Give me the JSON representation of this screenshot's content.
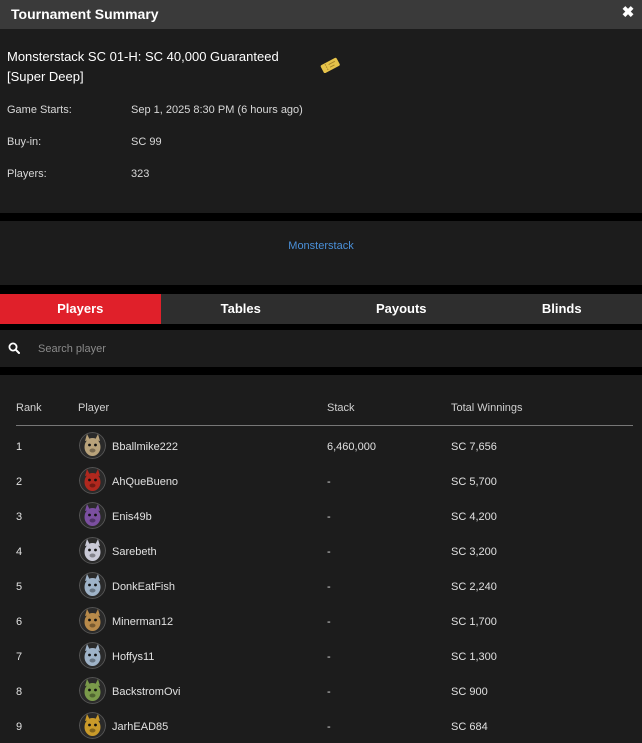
{
  "window": {
    "title": "Tournament Summary"
  },
  "tournament": {
    "name_line1": "Monsterstack SC 01-H: SC 40,000 Guaranteed",
    "name_line2": "[Super Deep]",
    "details": [
      {
        "label": "Game Starts:",
        "value": "Sep 1, 2025 8:30 PM (6 hours ago)"
      },
      {
        "label": "Buy-in:",
        "value": "SC 99"
      },
      {
        "label": "Players:",
        "value": "323"
      }
    ]
  },
  "series_link": "Monsterstack",
  "tabs": [
    "Players",
    "Tables",
    "Payouts",
    "Blinds"
  ],
  "active_tab": "Players",
  "search": {
    "placeholder": "Search player"
  },
  "table": {
    "headers": {
      "rank": "Rank",
      "player": "Player",
      "stack": "Stack",
      "winnings": "Total Winnings"
    },
    "rows": [
      {
        "rank": "1",
        "player": "Bballmike222",
        "stack": "6,460,000",
        "winnings": "SC 7,656",
        "avatar": "wolf-avatar",
        "avatar_color": "#b8a27a"
      },
      {
        "rank": "2",
        "player": "AhQueBueno",
        "stack": "-",
        "winnings": "SC 5,700",
        "avatar": "demon-avatar",
        "avatar_color": "#b0281e"
      },
      {
        "rank": "3",
        "player": "Enis49b",
        "stack": "-",
        "winnings": "SC 4,200",
        "avatar": "purple-beast-avatar",
        "avatar_color": "#7b4fa0"
      },
      {
        "rank": "4",
        "player": "Sarebeth",
        "stack": "-",
        "winnings": "SC 3,200",
        "avatar": "panda-avatar",
        "avatar_color": "#c9c9d6"
      },
      {
        "rank": "5",
        "player": "DonkEatFish",
        "stack": "-",
        "winnings": "SC 2,240",
        "avatar": "unicorn-avatar",
        "avatar_color": "#9fb3c8"
      },
      {
        "rank": "6",
        "player": "Minerman12",
        "stack": "-",
        "winnings": "SC 1,700",
        "avatar": "hamster-avatar",
        "avatar_color": "#b88a4a"
      },
      {
        "rank": "7",
        "player": "Hoffys11",
        "stack": "-",
        "winnings": "SC 1,300",
        "avatar": "unicorn-avatar",
        "avatar_color": "#9fb3c8"
      },
      {
        "rank": "8",
        "player": "BackstromOvi",
        "stack": "-",
        "winnings": "SC 900",
        "avatar": "horse-avatar",
        "avatar_color": "#7a9a4a"
      },
      {
        "rank": "9",
        "player": "JarhEAD85",
        "stack": "-",
        "winnings": "SC 684",
        "avatar": "soldier-avatar",
        "avatar_color": "#c99a2a"
      }
    ]
  },
  "colors": {
    "accent": "#e0202a",
    "link": "#4a90d9",
    "panel": "#1c1c1c",
    "titlebar": "#3a3a3a"
  }
}
